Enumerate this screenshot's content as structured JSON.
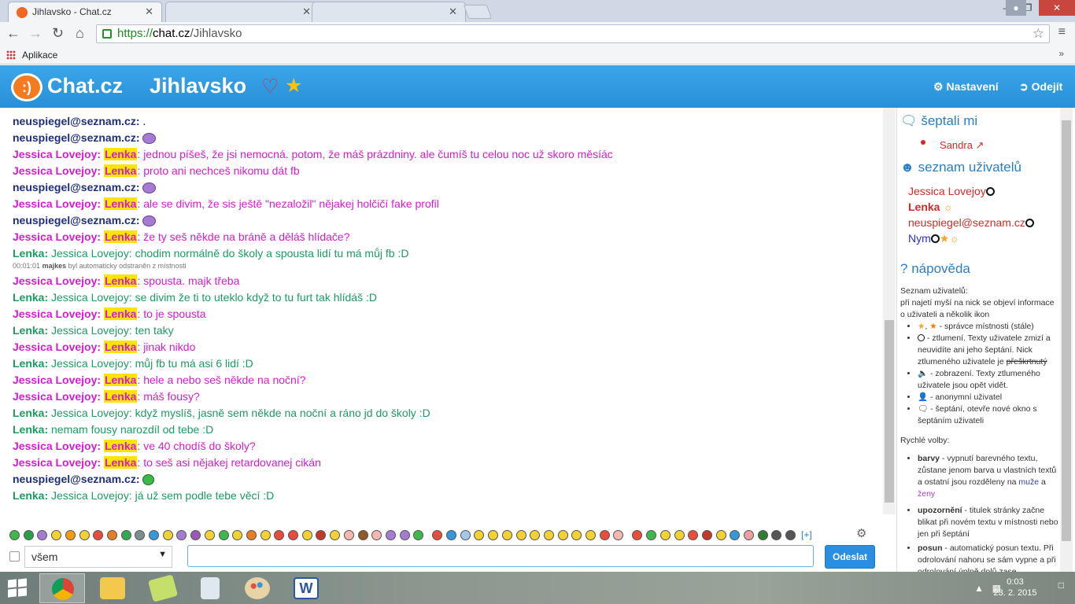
{
  "browser": {
    "tabs": [
      {
        "title": "Jihlavsko - Chat.cz",
        "active": true
      },
      {
        "title": "",
        "active": false
      },
      {
        "title": "",
        "active": false
      }
    ],
    "url_scheme": "https://",
    "url_host": "chat.cz",
    "url_path": "/Jihlavsko",
    "bookmark_apps": "Aplikace"
  },
  "header": {
    "logo": "Chat.cz",
    "room": "Jihlavsko",
    "settings": "Nastavení",
    "leave": "Odejít",
    "accent": "#2d97df"
  },
  "messages": [
    {
      "type": "neus",
      "nick": "neuspiegel@seznam.cz:",
      "text": "."
    },
    {
      "type": "neus",
      "nick": "neuspiegel@seznam.cz:",
      "text": "",
      "smiley": true
    },
    {
      "type": "jess",
      "nick": "Jessica Lovejoy:",
      "hl": "Lenka",
      "text": ": jednou píšeš, že jsi nemocná. potom, že máš prázdniny. ale čumíš tu celou noc už skoro měsíác"
    },
    {
      "type": "jess",
      "nick": "Jessica Lovejoy:",
      "hl": "Lenka",
      "text": ": proto ani nechceš nikomu dát fb"
    },
    {
      "type": "neus",
      "nick": "neuspiegel@seznam.cz:",
      "text": "",
      "smiley": true
    },
    {
      "type": "jess",
      "nick": "Jessica Lovejoy:",
      "hl": "Lenka",
      "text": ": ale se divim, že sis ještě \"nezaložil\" nějakej holčičí fake profil"
    },
    {
      "type": "neus",
      "nick": "neuspiegel@seznam.cz:",
      "text": "",
      "smiley": true
    },
    {
      "type": "jess",
      "nick": "Jessica Lovejoy:",
      "hl": "Lenka",
      "text": ": že ty seš někde na bráně a děláš hlídače?"
    },
    {
      "type": "lenka",
      "nick": "Lenka:",
      "text": "Jessica Lovejoy: chodim normálně do školy a spousta lidí tu má můj fb :D"
    },
    {
      "type": "jess",
      "nick": "Jessica Lovejoy:",
      "hl": "Lenka",
      "text": ": spousta. majk třeba"
    },
    {
      "type": "lenka",
      "nick": "Lenka:",
      "text": "Jessica Lovejoy: se divim že ti to uteklo když to tu furt tak hlídáš :D"
    },
    {
      "type": "jess",
      "nick": "Jessica Lovejoy:",
      "hl": "Lenka",
      "text": ": to je spousta"
    },
    {
      "type": "lenka",
      "nick": "Lenka:",
      "text": "Jessica Lovejoy: ten taky"
    },
    {
      "type": "jess",
      "nick": "Jessica Lovejoy:",
      "hl": "Lenka",
      "text": ": jinak nikdo"
    },
    {
      "type": "lenka",
      "nick": "Lenka:",
      "text": "Jessica Lovejoy: můj fb tu má asi 6 lidí :D"
    },
    {
      "type": "jess",
      "nick": "Jessica Lovejoy:",
      "hl": "Lenka",
      "text": ": hele a nebo seš někde na noční?"
    },
    {
      "type": "jess",
      "nick": "Jessica Lovejoy:",
      "hl": "Lenka",
      "text": ": máš fousy?"
    },
    {
      "type": "lenka",
      "nick": "Lenka:",
      "text": "Jessica Lovejoy: když myslíš, jasně sem někde na noční a ráno jd do školy :D"
    },
    {
      "type": "lenka",
      "nick": "Lenka:",
      "text": "nemam fousy narozdíl od tebe :D"
    },
    {
      "type": "jess",
      "nick": "Jessica Lovejoy:",
      "hl": "Lenka",
      "text": ": ve 40 chodíš do školy?"
    },
    {
      "type": "jess",
      "nick": "Jessica Lovejoy:",
      "hl": "Lenka",
      "text": ": to seš asi nějakej retardovanej cikán"
    },
    {
      "type": "neus",
      "nick": "neuspiegel@seznam.cz:",
      "text": "",
      "smiley": "green"
    },
    {
      "type": "lenka",
      "nick": "Lenka:",
      "text": "Jessica Lovejoy: já už sem podle tebe věcí :D"
    }
  ],
  "system_message": {
    "time": "00:01:01",
    "user": "majkes",
    "text": "byl automaticky odstraněn z místnosti"
  },
  "side": {
    "whispered_title": "šeptali mi",
    "whisper_user": "Sandra",
    "users_title": "seznam uživatelů",
    "users": [
      "Jessica Lovejoy",
      "Lenka",
      "neuspiegel@seznam.cz",
      "Nym"
    ],
    "help_title": "nápověda",
    "help_intro_1": "Seznam uživatelů:",
    "help_intro_2": "při najetí myší na nick se objeví informace o uživateli a několik ikon",
    "help_admin": " - správce místnosti (stále)",
    "help_mute": " - ztlumení. Texty uživatele zmizí a neuvidíte ani jeho šeptání. Nick ztlumeného uživatele je ",
    "help_strike": "přeškrtnutý",
    "help_show": " - zobrazení. Texty ztlumeného uživatele jsou opět vidět.",
    "help_anon": " - anonymní uživatel",
    "help_whisper": " - šeptání, otevře nové okno s šeptáním uživateli",
    "quick_title": "Rychlé volby:",
    "opt_colors_k": "barvy",
    "opt_colors_v": " - vypnutí barevného textu, zůstane jenom barva u vlastních textů a ostatní jsou rozděleny na ",
    "opt_men": "muže",
    "opt_and": " a ",
    "opt_women": "ženy",
    "opt_alert_k": "upozornění",
    "opt_alert_v": " - titulek stránky začne blikat při novém textu v místnosti nebo jen při šeptání",
    "opt_scroll_k": "posun",
    "opt_scroll_v": " - automatický posun textu. Při odrolování nahoru se sám vypne a při odrolování úplně dolů zase"
  },
  "input": {
    "target": "všem",
    "send": "Odeslat",
    "more_emotes": "[+]"
  },
  "taskbar": {
    "time": "0:03",
    "date": "23. 2. 2015"
  }
}
